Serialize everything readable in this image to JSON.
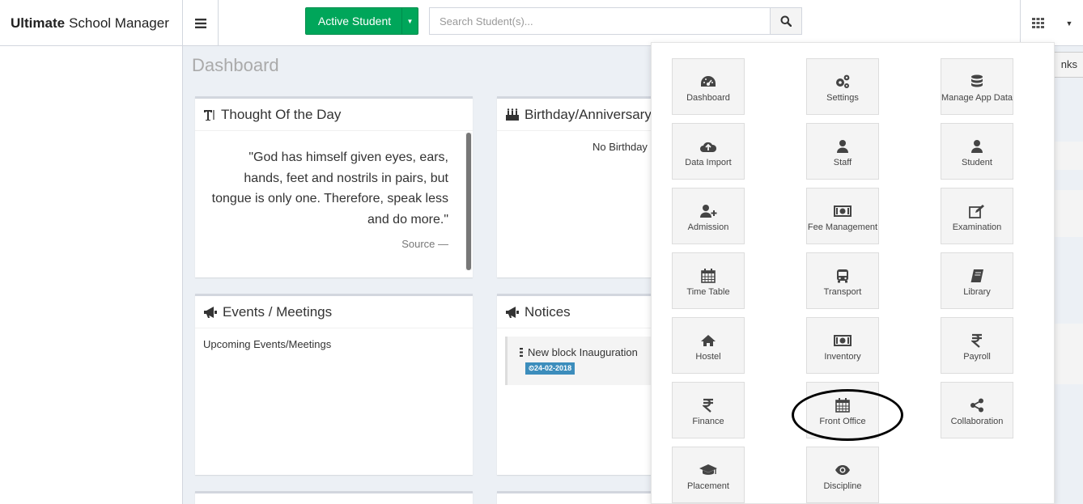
{
  "header": {
    "brand_bold": "Ultimate",
    "brand_rest": "School Manager",
    "active_student_label": "Active Student",
    "search_placeholder": "Search Student(s)..."
  },
  "page": {
    "title": "Dashboard",
    "quick_links_label": "nks"
  },
  "thought_box": {
    "title": "Thought Of the Day",
    "quote": "\"God has himself given eyes, ears, hands, feet and nostrils in pairs, but tongue is only one. Therefore, speak less and do more.\"",
    "source": "Source —"
  },
  "birthday_box": {
    "title": "Birthday/Anniversary",
    "message": "No Birthday"
  },
  "events_box": {
    "title": "Events / Meetings",
    "message": "Upcoming Events/Meetings"
  },
  "notices_box": {
    "title": "Notices",
    "items": [
      {
        "title": "New block Inauguration",
        "date": "24-02-2018"
      }
    ]
  },
  "apps": [
    {
      "label": "Dashboard",
      "icon": "dashboard-icon"
    },
    {
      "label": "Settings",
      "icon": "gears-icon"
    },
    {
      "label": "Manage App Data",
      "icon": "database-icon"
    },
    {
      "label": "Data Import",
      "icon": "cloud-upload-icon"
    },
    {
      "label": "Staff",
      "icon": "user-icon"
    },
    {
      "label": "Student",
      "icon": "user-icon"
    },
    {
      "label": "Admission",
      "icon": "user-plus-icon"
    },
    {
      "label": "Fee Management",
      "icon": "money-icon"
    },
    {
      "label": "Examination",
      "icon": "edit-icon"
    },
    {
      "label": "Time Table",
      "icon": "calendar-icon"
    },
    {
      "label": "Transport",
      "icon": "bus-icon"
    },
    {
      "label": "Library",
      "icon": "book-icon"
    },
    {
      "label": "Hostel",
      "icon": "home-icon"
    },
    {
      "label": "Inventory",
      "icon": "money-icon"
    },
    {
      "label": "Payroll",
      "icon": "rupee-icon"
    },
    {
      "label": "Finance",
      "icon": "rupee-icon"
    },
    {
      "label": "Front Office",
      "icon": "calendar-icon"
    },
    {
      "label": "Collaboration",
      "icon": "share-icon"
    },
    {
      "label": "Placement",
      "icon": "graduation-cap-icon"
    },
    {
      "label": "Discipline",
      "icon": "eye-icon"
    }
  ],
  "colors": {
    "accent_green": "#00a65a",
    "badge_blue": "#3c8dbc",
    "content_bg": "#ecf0f5"
  }
}
